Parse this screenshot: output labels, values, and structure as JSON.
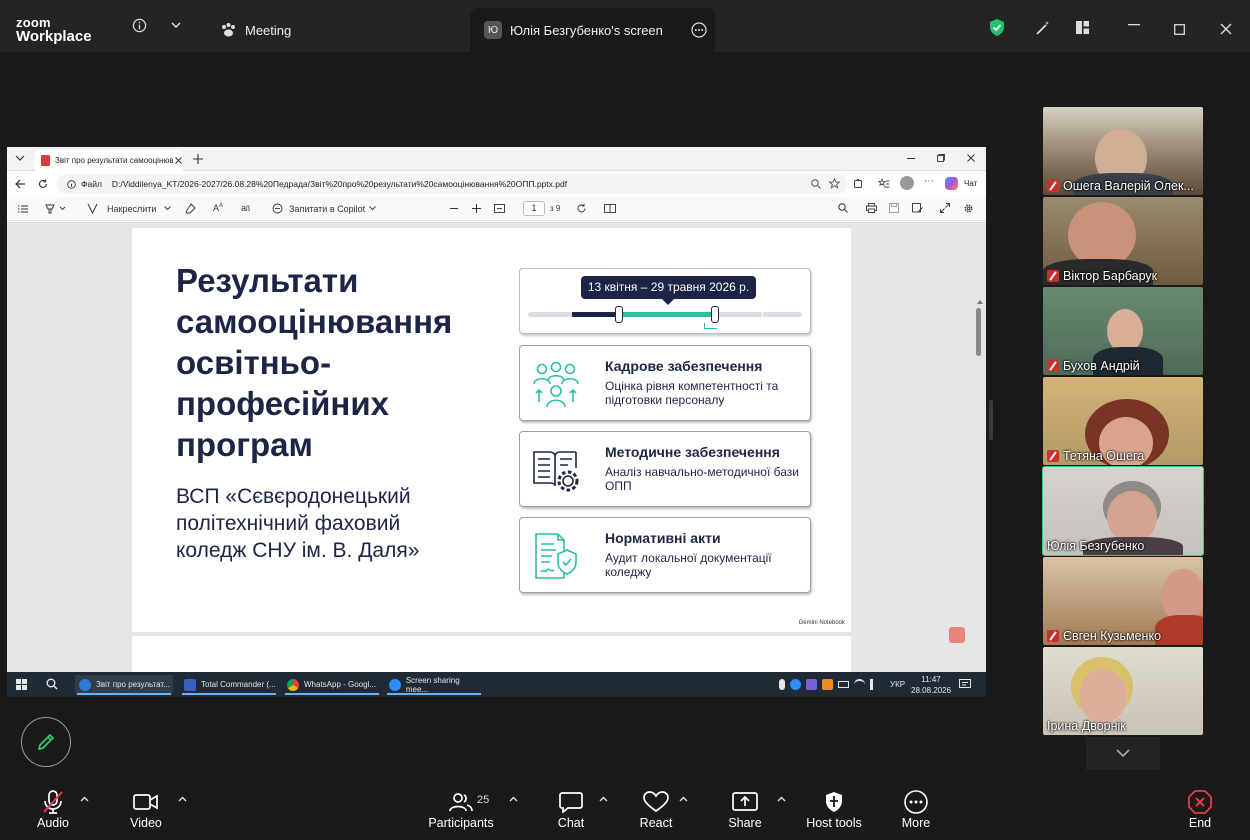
{
  "app": {
    "logo_line1": "zoom",
    "logo_line2": "Workplace",
    "meeting_tab": "Meeting",
    "share_tab_initial": "Ю",
    "share_tab": "Юлія Безгубенко's screen"
  },
  "browser": {
    "tab_title": "Звіт про результати самооцінюв...",
    "address_prefix": "Файл",
    "address": "D:/Viddilenya_KT/2026-2027/26.08.28%20Педрада/Звіт%20про%20результати%20самооцінювання%20ОПП.pptx.pdf",
    "chat_label": "Чат",
    "pdf_toolbar": {
      "draw_label": "Накреслити",
      "copilot_label": "Запитати в Copilot",
      "page_current": "1",
      "page_total": "з 9"
    }
  },
  "slide": {
    "title": "Результати самооцінювання освітньо-професійних програм",
    "subtitle": "ВСП «Сєвєродонецький політехнічний фаховий коледж СНУ ім. В. Даля»",
    "timeline_label": "13 квітня – 29 травня 2026 р.",
    "cards": [
      {
        "title": "Кадрове забезпечення",
        "desc": "Оцінка рівня компетентності та підготовки персоналу",
        "icon": "people-icon"
      },
      {
        "title": "Методичне забезпечення",
        "desc": "Аналіз навчально-методичної бази ОПП",
        "icon": "book-gear-icon"
      },
      {
        "title": "Нормативні акти",
        "desc": "Аудит локальної документації коледжу",
        "icon": "document-shield-icon"
      }
    ],
    "watermark": "Gemini Notebook"
  },
  "taskbar": {
    "items": [
      {
        "label": "Звіт про результат...",
        "color": "#2e7bd6"
      },
      {
        "label": "Total Commander (...",
        "color": "#3b5fc0"
      },
      {
        "label": "WhatsApp - Googl...",
        "color": "#e8b52c"
      },
      {
        "label": "Screen sharing mee...",
        "color": "#2d8cff"
      }
    ],
    "lang": "УКР",
    "time": "11:47",
    "date": "28.08.2026"
  },
  "participants": [
    {
      "name": "Ошега Валерій Олек...",
      "muted": true,
      "bg": "#8c7a64"
    },
    {
      "name": "Віктор Барбарук",
      "muted": true,
      "bg": "#6e5a40"
    },
    {
      "name": "Бухов Андрій",
      "muted": true,
      "bg": "#5b7a64"
    },
    {
      "name": "Тетяна Ошега",
      "muted": true,
      "bg": "#b29a68"
    },
    {
      "name": "Юлія Безгубенко",
      "muted": false,
      "bg": "#c4c0bc"
    },
    {
      "name": "Євген Кузьменко",
      "muted": true,
      "bg": "#a07a52"
    },
    {
      "name": "Ірина Дворнік",
      "muted": false,
      "bg": "#c9c3b5"
    }
  ],
  "toolbar": {
    "audio": "Audio",
    "video": "Video",
    "participants": "Participants",
    "participants_count": "25",
    "chat": "Chat",
    "react": "React",
    "share": "Share",
    "host_tools": "Host tools",
    "more": "More",
    "end": "End"
  },
  "colors": {
    "slide_navy": "#1c2545",
    "teal": "#2bbfa4",
    "end_red": "#e8394f",
    "shield_green": "#1ec36b",
    "active_speaker": "#2dd46f"
  }
}
